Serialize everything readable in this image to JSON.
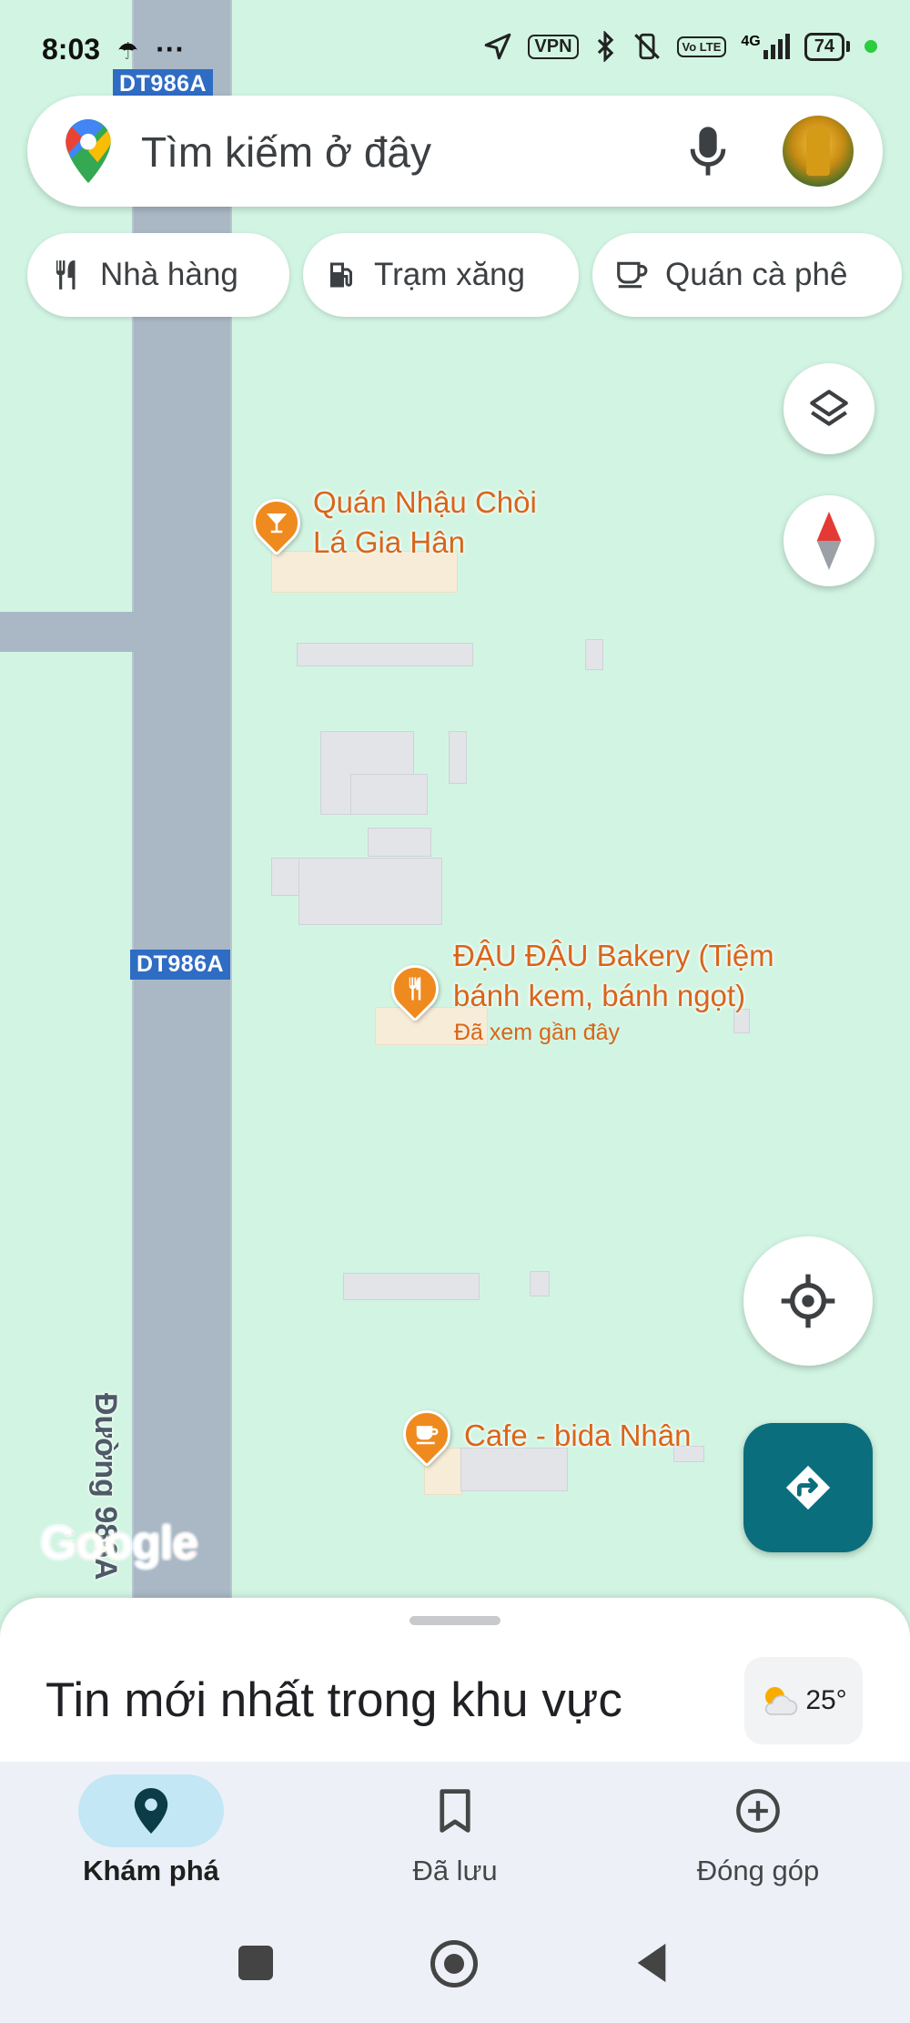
{
  "status_bar": {
    "time": "8:03",
    "more": "···",
    "vpn": "VPN",
    "volte": "Vo LTE",
    "network": "4G",
    "battery": "74"
  },
  "map": {
    "road_shield_top": "DT986A",
    "road_shield_mid": "DT986A",
    "road_name": "Đường 986A",
    "google_logo": "Google",
    "pois": [
      {
        "line1": "Quán Nhậu Chòi",
        "line2": "Lá Gia Hân",
        "icon": "cocktail-icon"
      },
      {
        "line1": "ĐẬU ĐẬU Bakery (Tiệm",
        "line2": "bánh kem, bánh ngọt)",
        "sub": "Đã xem gần đây",
        "icon": "restaurant-icon"
      },
      {
        "line1": "Cafe - bida Nhân",
        "icon": "coffee-icon"
      }
    ]
  },
  "search": {
    "placeholder": "Tìm kiếm ở đây",
    "mic_icon": "mic-icon",
    "logo_icon": "maps-pin-logo"
  },
  "chips": [
    {
      "label": "Nhà hàng",
      "icon": "restaurant-icon"
    },
    {
      "label": "Trạm xăng",
      "icon": "gas-station-icon"
    },
    {
      "label": "Quán cà phê",
      "icon": "coffee-icon"
    }
  ],
  "sheet": {
    "title": "Tin mới nhất trong khu vực",
    "weather_temp": "25°",
    "weather_icon": "partly-cloudy-icon"
  },
  "nav": {
    "items": [
      {
        "label": "Khám phá",
        "icon": "location-pin-icon",
        "active": true
      },
      {
        "label": "Đã lưu",
        "icon": "bookmark-icon",
        "active": false
      },
      {
        "label": "Đóng góp",
        "icon": "add-circle-icon",
        "active": false
      }
    ]
  },
  "colors": {
    "map_bg": "#d2f5e3",
    "road": "#aab8c5",
    "poi_orange": "#d9651a",
    "directions_fab": "#0b6e7d",
    "nav_active_pill": "#c3e7f4"
  }
}
